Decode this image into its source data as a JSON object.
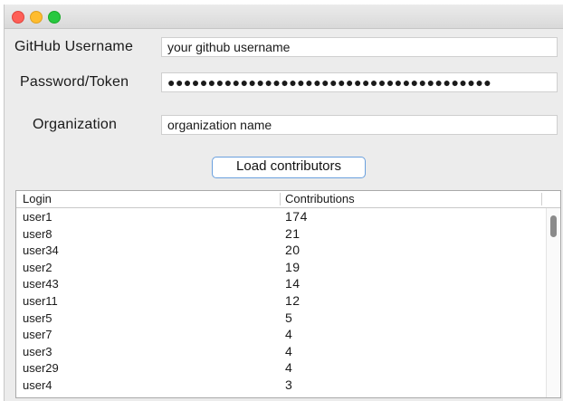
{
  "form": {
    "username": {
      "label": "GitHub Username",
      "value": "your github username"
    },
    "password": {
      "label": "Password/Token",
      "value": "●●●●●●●●●●●●●●●●●●●●●●●●●●●●●●●●●●●●●●●●"
    },
    "organization": {
      "label": "Organization",
      "value": "organization name"
    },
    "load_button": "Load contributors"
  },
  "table": {
    "columns": [
      "Login",
      "Contributions"
    ],
    "rows": [
      [
        "user1",
        "174"
      ],
      [
        "user8",
        "21"
      ],
      [
        "user34",
        "20"
      ],
      [
        "user2",
        "19"
      ],
      [
        "user43",
        "14"
      ],
      [
        "user11",
        "12"
      ],
      [
        "user5",
        "5"
      ],
      [
        "user7",
        "4"
      ],
      [
        "user3",
        "4"
      ],
      [
        "user29",
        "4"
      ],
      [
        "user4",
        "3"
      ]
    ]
  }
}
